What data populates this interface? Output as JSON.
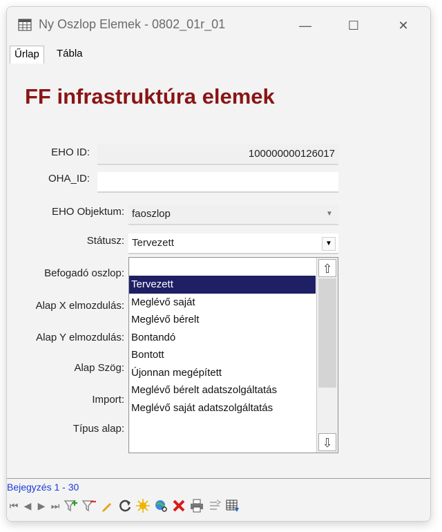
{
  "window": {
    "title": "Ny Oszlop Elemek - 0802_01r_01",
    "minimize": "—",
    "maximize": "☐",
    "close": "✕"
  },
  "tabs": [
    {
      "label": "Űrlap",
      "active": true
    },
    {
      "label": "Tábla",
      "active": false
    }
  ],
  "form": {
    "title": "FF infrastruktúra elemek",
    "eho_id": {
      "label": "EHO ID:",
      "value": "100000000126017"
    },
    "oha_id": {
      "label": "OHA_ID:",
      "value": ""
    },
    "eho_objektum": {
      "label": "EHO Objektum:",
      "value": "faoszlop"
    },
    "statusz": {
      "label": "Státusz:",
      "value": "Tervezett"
    },
    "befogado_oszlop": {
      "label": "Befogadó oszlop:"
    },
    "alap_x": {
      "label": "Alap X elmozdulás:"
    },
    "alap_y": {
      "label": "Alap Y elmozdulás:"
    },
    "alap_szog": {
      "label": "Alap Szög:"
    },
    "import": {
      "label": "Import:"
    },
    "tipus_alap": {
      "label": "Típus alap:"
    }
  },
  "dropdown": {
    "options": [
      "Tervezett",
      "Meglévő saját",
      "Meglévő bérelt",
      "Bontandó",
      "Bontott",
      "Újonnan megépített",
      "Meglévő bérelt adatszolgáltatás",
      "Meglévő saját adatszolgáltatás"
    ],
    "selected_index": 0,
    "scroll_up": "⇧",
    "scroll_down": "⇩"
  },
  "status": {
    "record_count": "Bejegyzés 1 - 30"
  },
  "colors": {
    "title_red": "#8b1414",
    "selection": "#1f1f66",
    "record_blue": "#1a3bd6"
  },
  "toolbar": {
    "first": "⏮",
    "prev": "◀",
    "next": "▶",
    "last": "⏭"
  }
}
